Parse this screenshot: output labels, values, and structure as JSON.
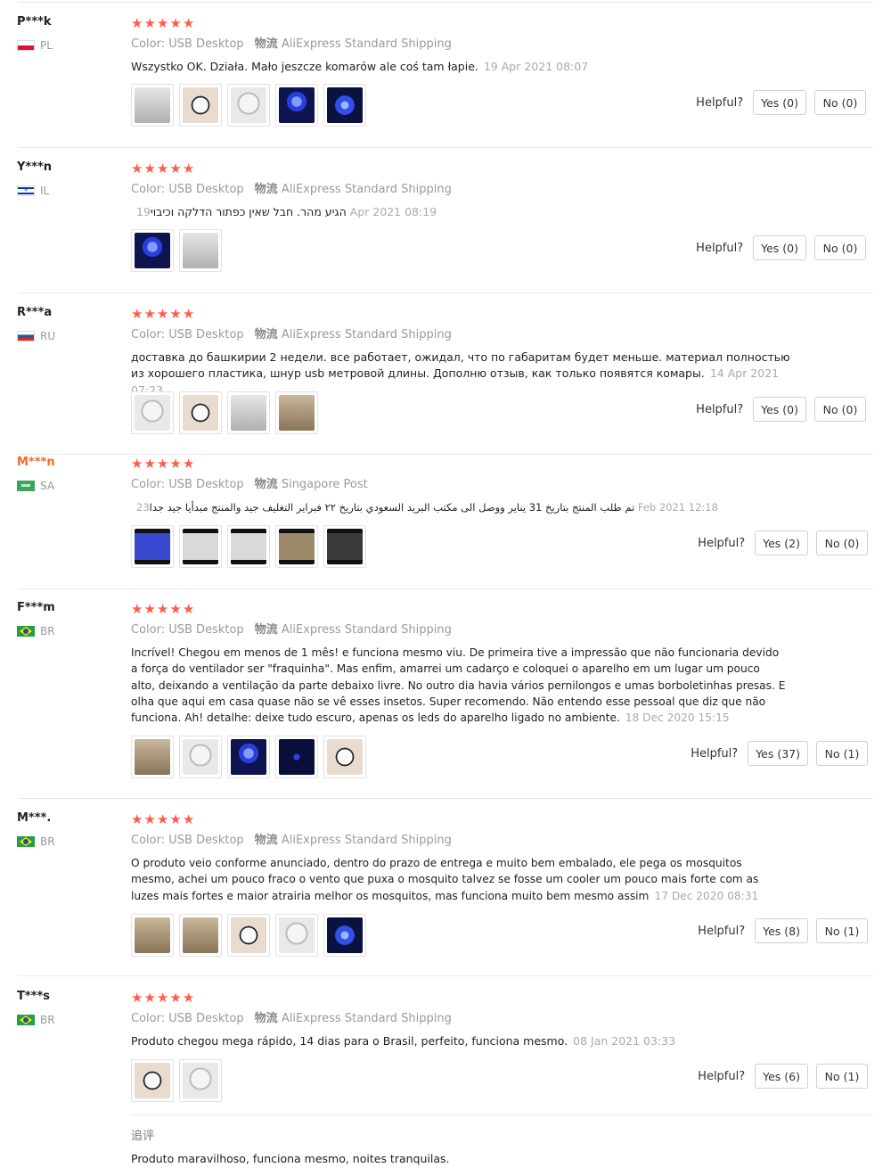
{
  "helpful_label": "Helpful?",
  "color_label": "Color:",
  "shipping_label": "物流",
  "reviews": [
    {
      "user": "P***k",
      "country": "PL",
      "color": "USB Desktop",
      "shipping": "AliExpress Standard Shipping",
      "text": "Wszystko OK. Działa. Mało jeszcze komarów ale coś tam łapie.",
      "date": "19 Apr 2021 08:07",
      "yes": "Yes (0)",
      "no": "No (0)"
    },
    {
      "user": "Y***n",
      "country": "IL",
      "color": "USB Desktop",
      "shipping": "AliExpress Standard Shipping",
      "text": "הגיע מהר. חבל שאין כפתור הדלקה וכיבוי",
      "date": "19 Apr 2021 08:19",
      "yes": "Yes (0)",
      "no": "No (0)"
    },
    {
      "user": "R***a",
      "country": "RU",
      "color": "USB Desktop",
      "shipping": "AliExpress Standard Shipping",
      "text": "доставка до башкирии 2 недели. все работает, ожидал, что по габаритам будет меньше. материал полностью из хорошего пластика, шнур usb метровой длины. Дополню отзыв, как только появятся комары.",
      "date": "14 Apr 2021 07:23",
      "yes": "Yes (0)",
      "no": "No (0)"
    },
    {
      "user": "M***n",
      "country": "SA",
      "color": "USB Desktop",
      "shipping": "Singapore Post",
      "text": "تم طلب المنتج بتاريخ 31 يناير ووصل الى مكتب البريد السعودي بتاريخ ٢٢ فبراير التغليف جيد والمنتج مبدأيا جيد جدا",
      "date": "23 Feb 2021 12:18",
      "yes": "Yes (2)",
      "no": "No (0)"
    },
    {
      "user": "F***m",
      "country": "BR",
      "color": "USB Desktop",
      "shipping": "AliExpress Standard Shipping",
      "text": "Incrível! Chegou em menos de 1 mês! e funciona mesmo viu. De primeira tive a impressão que não funcionaria devido a força do ventilador ser \"fraquinha\". Mas enfim, amarrei um cadarço e coloquei o aparelho em um lugar um pouco alto, deixando a ventilação da parte debaixo livre. No outro dia havia vários pernilongos e umas borboletinhas presas. E olha que aqui em casa quase não se vê esses insetos. Super recomendo. Não entendo esse pessoal que diz que não funciona. Ah! detalhe: deixe tudo escuro, apenas os leds do aparelho ligado no ambiente.",
      "date": "18 Dec 2020 15:15",
      "yes": "Yes (37)",
      "no": "No (1)"
    },
    {
      "user": "M***.",
      "country": "BR",
      "color": "USB Desktop",
      "shipping": "AliExpress Standard Shipping",
      "text": "O produto veio conforme anunciado, dentro do prazo de entrega e muito bem embalado, ele pega os mosquitos mesmo, achei um pouco fraco o vento que puxa o mosquito talvez se fosse um cooler um pouco mais forte com as luzes mais fortes e maior atrairia melhor os mosquitos, mas funciona muito bem mesmo assim",
      "date": "17 Dec 2020 08:31",
      "yes": "Yes (8)",
      "no": "No (1)"
    },
    {
      "user": "T***s",
      "country": "BR",
      "color": "USB Desktop",
      "shipping": "AliExpress Standard Shipping",
      "text": "Produto chegou mega rápido, 14 dias para o Brasil, perfeito, funciona mesmo.",
      "date": "08 Jan 2021 03:33",
      "yes": "Yes (6)",
      "no": "No (1)"
    }
  ],
  "followup": {
    "title": "追评",
    "text": "Produto maravilhoso, funciona mesmo, noites tranquilas."
  }
}
